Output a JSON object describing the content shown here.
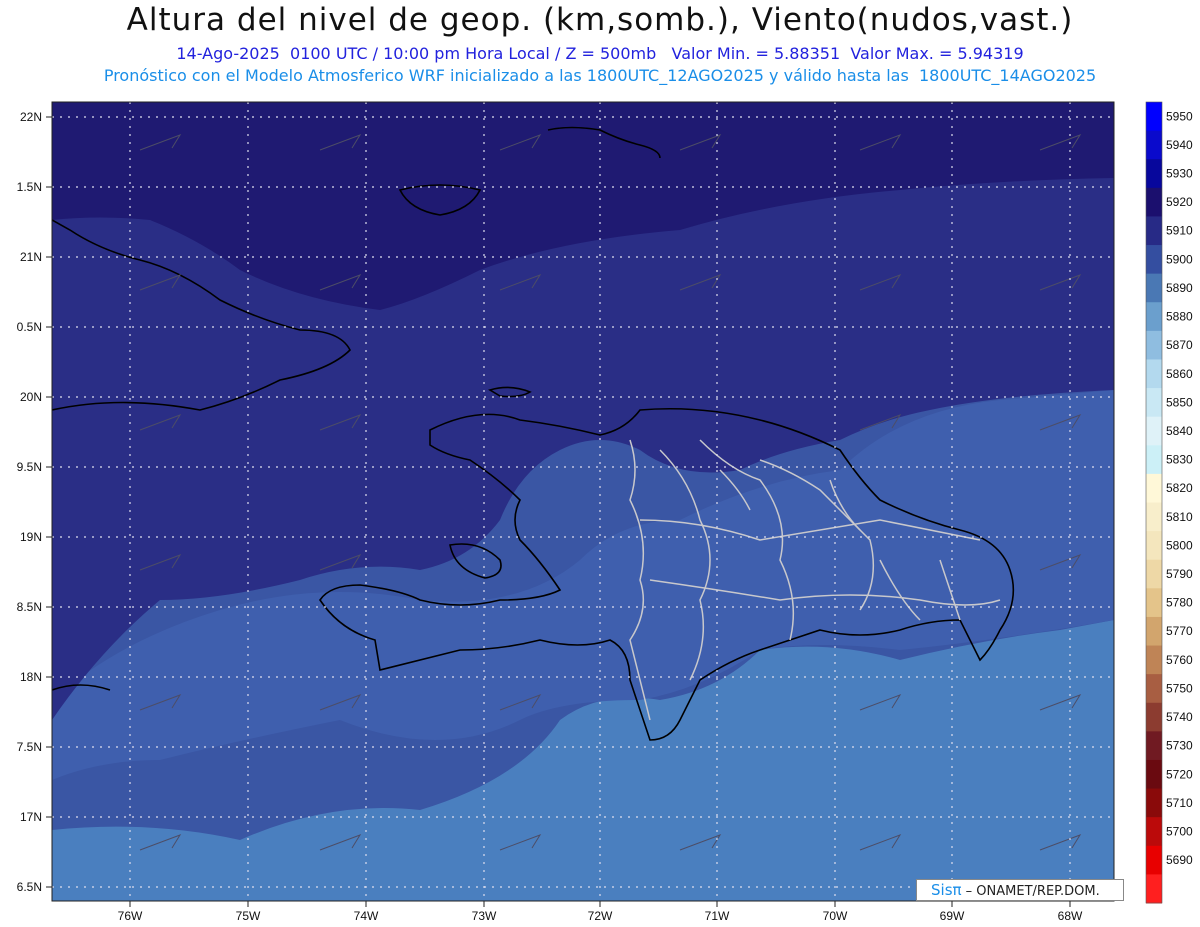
{
  "header": {
    "title": "Altura del nivel de geop. (km,somb.), Viento(nudos,vast.)",
    "line1": "14-Ago-2025  0100 UTC / 10:00 pm Hora Local / Z = 500mb   Valor Min. = 5.88351  Valor Max. = 5.94319",
    "line2": "Pronóstico con el Modelo Atmosferico WRF inicializado a las 1800UTC_12AGO2025 y válido hasta las  1800UTC_14AGO2025"
  },
  "axes": {
    "lat_labels": [
      "22N",
      "1.5N",
      "21N",
      "0.5N",
      "20N",
      "9.5N",
      "19N",
      "8.5N",
      "18N",
      "7.5N",
      "17N",
      "6.5N"
    ],
    "lon_labels": [
      "76W",
      "75W",
      "74W",
      "73W",
      "72W",
      "71W",
      "70W",
      "69W",
      "68W"
    ]
  },
  "colorbar": {
    "levels": [
      "5950",
      "5940",
      "5930",
      "5920",
      "5910",
      "5900",
      "5890",
      "5880",
      "5870",
      "5860",
      "5850",
      "5840",
      "5830",
      "5820",
      "5810",
      "5800",
      "5790",
      "5780",
      "5770",
      "5760",
      "5750",
      "5740",
      "5730",
      "5720",
      "5710",
      "5700",
      "5690"
    ],
    "colors": [
      "#0000ff",
      "#0a0acc",
      "#07079c",
      "#1b0f6e",
      "#272a86",
      "#344ea0",
      "#4a78b4",
      "#6b9fcd",
      "#8fbde0",
      "#b3d9ee",
      "#c9e8f4",
      "#dff2f8",
      "#ccf0f7",
      "#fff8d8",
      "#f8eecb",
      "#f4e6bd",
      "#eed8a6",
      "#e4c48a",
      "#d2a56d",
      "#bf8456",
      "#a85e42",
      "#8c3c30",
      "#701a22",
      "#6a0a10",
      "#8a0a0a",
      "#bb0a0a",
      "#e80000",
      "#ff1f1f"
    ]
  },
  "credit": {
    "logo": "Sisπ",
    "text": " – ONAMET/REP.DOM."
  }
}
